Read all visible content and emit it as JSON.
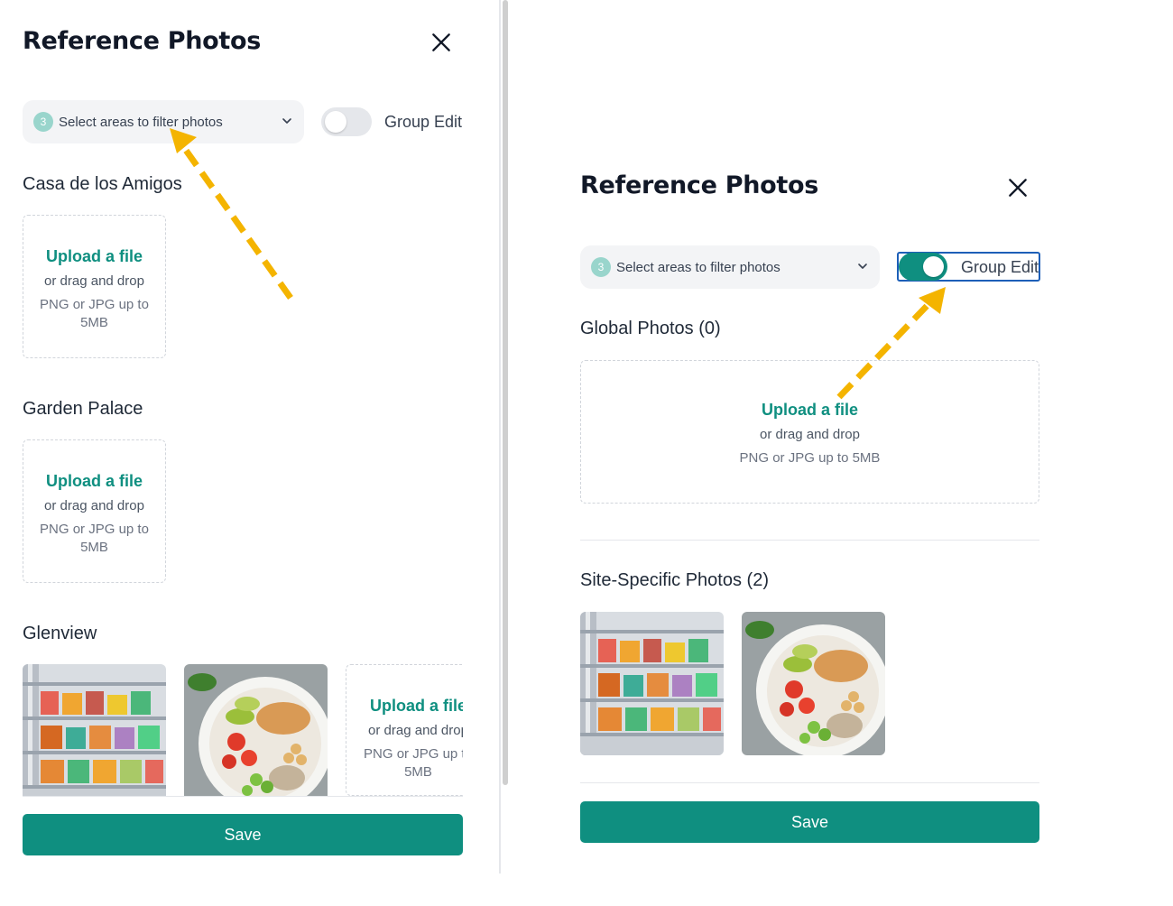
{
  "colors": {
    "accent": "#0f8f80",
    "badge": "#99d5cc",
    "arrow": "#f4b400",
    "focus_ring": "#1d5fb8",
    "select_bg": "#f3f4f6"
  },
  "left": {
    "title": "Reference Photos",
    "filter": {
      "badge_count": "3",
      "placeholder": "Select areas to filter photos"
    },
    "toggle": {
      "label": "Group Edit",
      "state": "off"
    },
    "sites": [
      {
        "name": "Casa de los Amigos"
      },
      {
        "name": "Garden Palace"
      },
      {
        "name": "Glenview"
      }
    ],
    "upload": {
      "link": "Upload a file",
      "sub": "or drag and drop",
      "hint": "PNG or JPG up to 5MB"
    },
    "save_label": "Save"
  },
  "right": {
    "title": "Reference Photos",
    "filter": {
      "badge_count": "3",
      "placeholder": "Select areas to filter photos"
    },
    "toggle": {
      "label": "Group Edit",
      "state": "on"
    },
    "global_heading": "Global Photos (0)",
    "upload": {
      "link": "Upload a file",
      "sub": "or drag and drop",
      "hint": "PNG or JPG up to 5MB"
    },
    "site_specific_heading": "Site-Specific Photos (2)",
    "photos": [
      "fridge-shelves-photo",
      "salad-bowl-photo"
    ],
    "save_label": "Save"
  }
}
